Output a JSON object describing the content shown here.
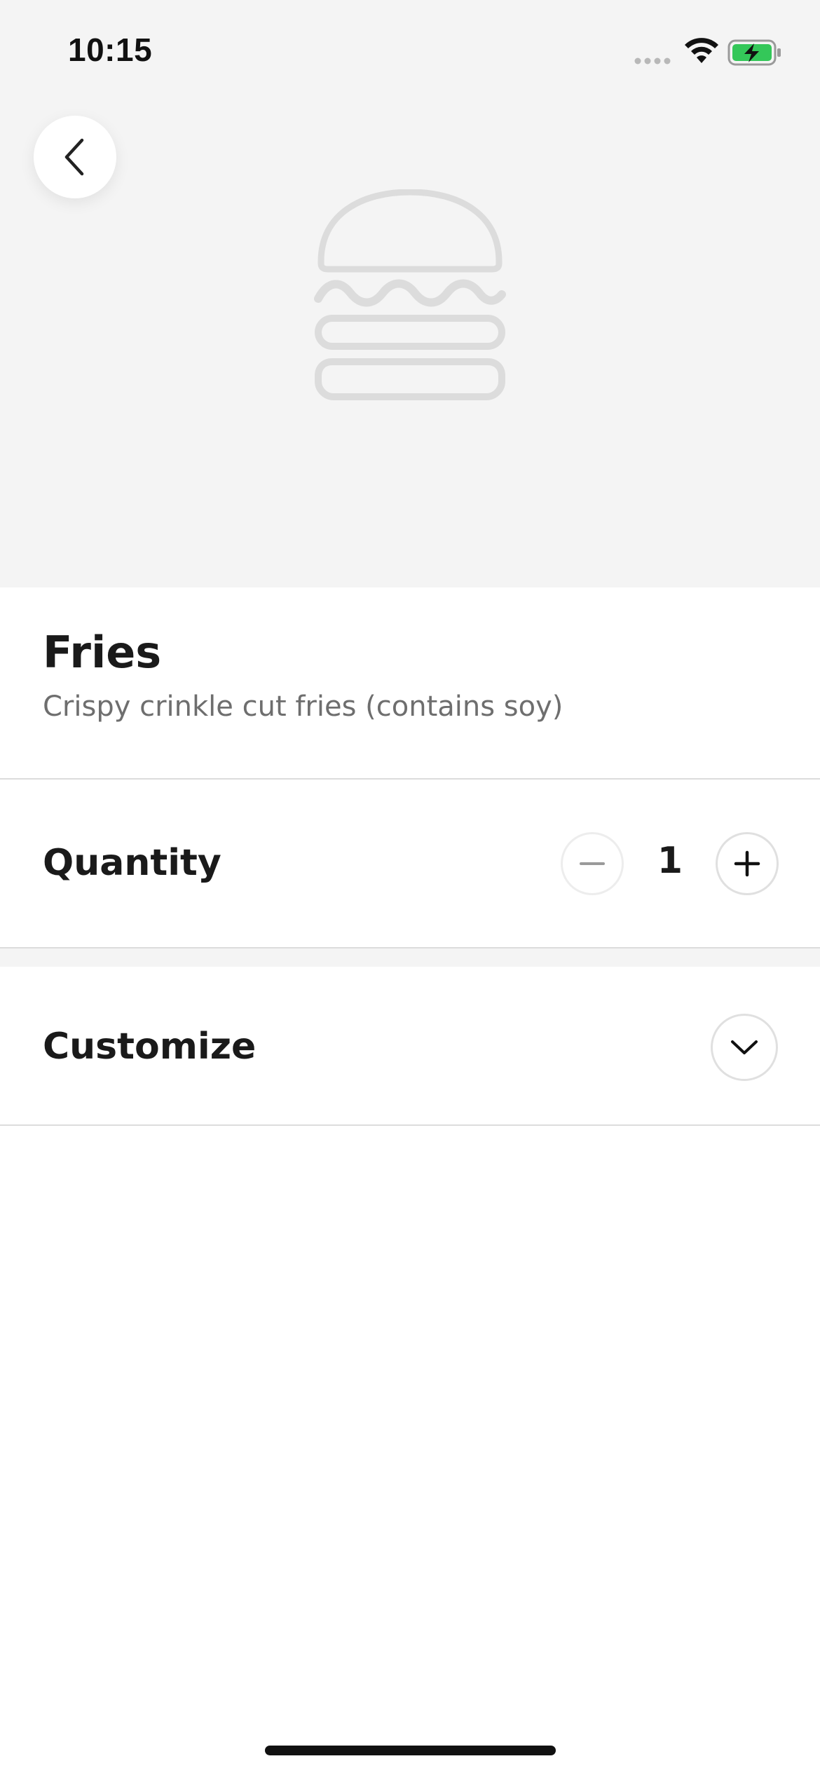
{
  "status_bar": {
    "time": "10:15"
  },
  "colors": {
    "hero_background": "#f4f4f4",
    "placeholder_gray": "#dcdcdc",
    "battery_green": "#34c759",
    "text_primary": "#1a1a1a",
    "text_secondary": "#6e6e6e"
  },
  "icons": {
    "back": "chevron-left-icon",
    "hero": "burger-placeholder-icon",
    "decrement": "minus-icon",
    "increment": "plus-icon",
    "expand": "chevron-down-icon"
  },
  "item": {
    "title": "Fries",
    "description": "Crispy crinkle cut fries (contains soy)"
  },
  "quantity": {
    "label": "Quantity",
    "value": "1"
  },
  "customize": {
    "label": "Customize"
  }
}
